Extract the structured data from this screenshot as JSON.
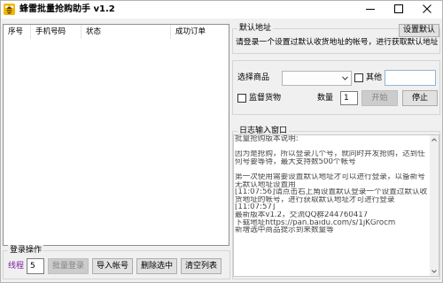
{
  "window": {
    "title": "蜂雷批量抢购助手 v1.2"
  },
  "icons": {
    "app": "app-icon",
    "minimize": "minimize-icon",
    "maximize": "maximize-icon",
    "close": "close-icon",
    "dropdown": "chevron-down-icon",
    "scroll_up": "scroll-up-arrow-icon",
    "scroll_down": "scroll-down-arrow-icon"
  },
  "colors": {
    "window_bg": "#f0f0f0",
    "thread_label": "#7b1fa2",
    "disabled_text": "#838383",
    "log_text": "#444444"
  },
  "account_table": {
    "columns": [
      "序号",
      "手机号码",
      "状态",
      "成功订单"
    ],
    "rows": []
  },
  "login_ops": {
    "title": "登录操作",
    "thread_label": "线程",
    "thread_value": "5",
    "batch_login_label": "批量登录",
    "batch_login_enabled": false,
    "import_label": "导入帐号",
    "delete_selected_label": "删除选中",
    "clear_list_label": "清空列表"
  },
  "default_address": {
    "title": "默认地址",
    "set_default_label": "设置默认",
    "text": "请登录一个设置过默认收货地址的帐号，进行获取默认地址"
  },
  "product": {
    "select_label": "选择商品",
    "selected": "",
    "other_label": "其他",
    "other_checked": false,
    "other_value": "",
    "monitor_label": "监督货物",
    "monitor_checked": false,
    "quantity_label": "数量",
    "quantity_value": "1",
    "start_label": "开始",
    "start_enabled": false,
    "stop_label": "停止"
  },
  "log": {
    "title": "日志输入窗口",
    "lines": [
      "批量抢购版本说明:",
      "",
      "因为是抢购，所以登录几个号，就同时并发抢购，达到任",
      "何号要等待，最大支持数500个帐号",
      "",
      "第一次使用需要设置默认地址才可以进行登录，以备新号",
      "无默认地址设置用",
      "[11:07:56]请点击右上角设置默认登录一个设置过默认收",
      "货地址的帐号，进行获取默认地址才可进行登录",
      "[11:07:57]",
      "最新版本v1.2，交流QQ群244760417",
      "下载地址https://pan.baidu.com/s/1jKGrocm",
      "新增选中商品提示到来数量等"
    ]
  }
}
